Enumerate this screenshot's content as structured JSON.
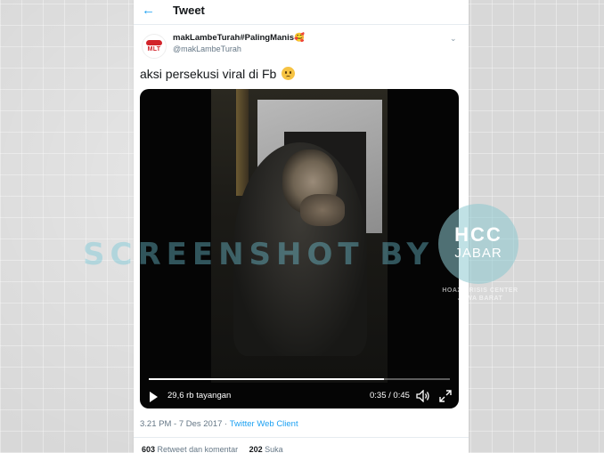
{
  "header": {
    "title": "Tweet"
  },
  "tweet": {
    "avatar_text": "MLT",
    "display_name": "makLambeTurah#PalingManis🥰",
    "handle": "@makLambeTurah",
    "text": "aksi persekusi viral di Fb",
    "text_emoji": "worried-face-icon",
    "timestamp": "3.21 PM - 7 Des 2017",
    "separator": " · ",
    "client": "Twitter Web Client"
  },
  "video": {
    "views": "29,6 rb tayangan",
    "time": "0:35 / 0:45",
    "progress": 0.78
  },
  "watermarks": {
    "text": "SCREENSHOT BY",
    "logo_letters": "HCC",
    "logo_sub": "JABAR",
    "caption_line1": "HOAX CRISIS CENTER",
    "caption_line2": "JAWA BARAT"
  },
  "stats": {
    "retweets_count": "603",
    "retweets_label": "Retweet dan komentar",
    "likes_count": "202",
    "likes_label": "Suka"
  },
  "colors": {
    "accent": "#1da1f2",
    "text": "#14171a",
    "secondary": "#657786"
  }
}
